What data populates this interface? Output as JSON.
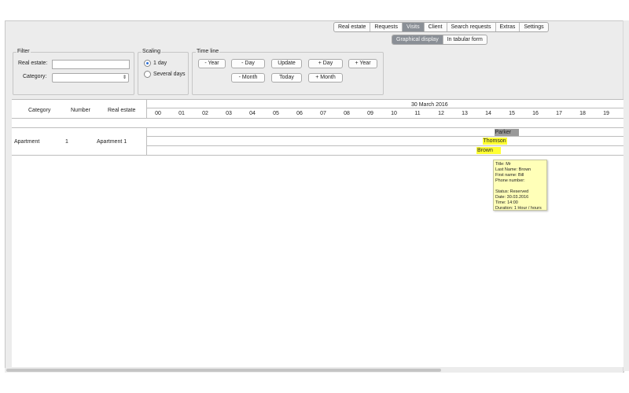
{
  "main_tabs": {
    "items": [
      "Real estate",
      "Requests",
      "Visits",
      "Client",
      "Search requests",
      "Extras",
      "Settings"
    ],
    "active": "Visits"
  },
  "display_toggle": {
    "items": [
      "Graphical display",
      "In tabular form"
    ],
    "active": "Graphical display"
  },
  "filter": {
    "legend": "Filter",
    "real_estate_label": "Real estate:",
    "real_estate_value": "",
    "category_label": "Category:",
    "category_value": ""
  },
  "scaling": {
    "legend": "Scaling",
    "options": [
      "1 day",
      "Several days"
    ],
    "selected": "1 day"
  },
  "time_line": {
    "legend": "Time line",
    "buttons": {
      "minus_year": "- Year",
      "minus_day": "- Day",
      "update": "Update",
      "plus_day": "+ Day",
      "plus_year": "+ Year",
      "minus_month": "- Month",
      "today": "Today",
      "plus_month": "+ Month"
    }
  },
  "schedule": {
    "columns": [
      "Category",
      "Number",
      "Real estate"
    ],
    "date": "30 March 2016",
    "hours": [
      "00",
      "01",
      "02",
      "03",
      "04",
      "05",
      "06",
      "07",
      "08",
      "09",
      "10",
      "11",
      "12",
      "13",
      "14",
      "15",
      "16",
      "17",
      "18",
      "19"
    ],
    "row": {
      "category": "Apartment",
      "number": "1",
      "real_estate": "Apartment 1"
    },
    "bookings": [
      {
        "name": "Parker",
        "start": 14.25,
        "end": 15.25,
        "color": "#9a9a9a"
      },
      {
        "name": "Thomson",
        "start": 13.75,
        "end": 14.75,
        "color": "#ffff33"
      },
      {
        "name": "Brown",
        "start": 13.5,
        "end": 14.5,
        "color": "#ffff33"
      }
    ]
  },
  "tooltip": {
    "title": "Title: Mr",
    "last_name": "Last Name: Brown",
    "first_name": "First name: Bill",
    "phone": "Phone number:",
    "status": "Status: Reserved",
    "date": "Date: 30.03.2016",
    "time": "Time: 14:00",
    "duration": "Duration: 1 Hour / hours"
  }
}
